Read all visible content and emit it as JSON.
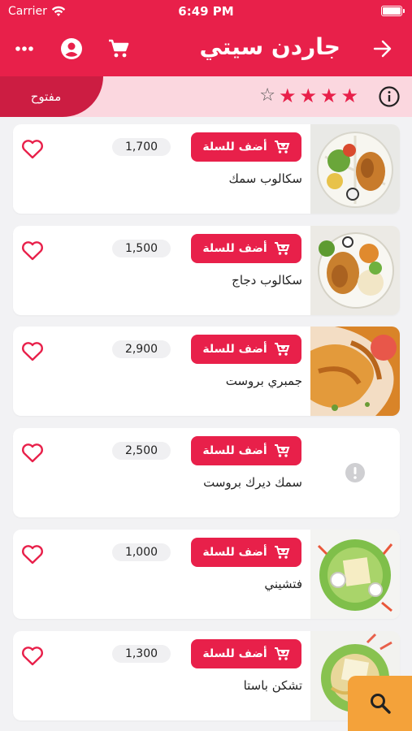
{
  "status_bar": {
    "carrier": "Carrier",
    "time": "6:49 PM"
  },
  "header": {
    "title": "جاردن سيتي"
  },
  "subbar": {
    "status": "مفتوح",
    "rating": 4,
    "rating_max": 5
  },
  "colors": {
    "primary": "#e8204a",
    "badge": "#cc1d42",
    "subbar_bg": "#fbd7df",
    "fab": "#f4a23a"
  },
  "items": [
    {
      "name": "سكالوب سمك",
      "price": "1,700",
      "add_label": "أضف للسلة",
      "image": "plate-fish-scallop"
    },
    {
      "name": "سكالوب دجاج",
      "price": "1,500",
      "add_label": "أضف للسلة",
      "image": "plate-chicken-scallop"
    },
    {
      "name": "جمبري بروست",
      "price": "2,900",
      "add_label": "أضف للسلة",
      "image": "fried-shrimp"
    },
    {
      "name": "سمك ديرك بروست",
      "price": "2,500",
      "add_label": "أضف للسلة",
      "image": "missing-image"
    },
    {
      "name": "فتشيني",
      "price": "1,000",
      "add_label": "أضف للسلة",
      "image": "pasta-salad"
    },
    {
      "name": "تشكن باستا",
      "price": "1,300",
      "add_label": "أضف للسلة",
      "image": "chicken-pasta"
    }
  ]
}
